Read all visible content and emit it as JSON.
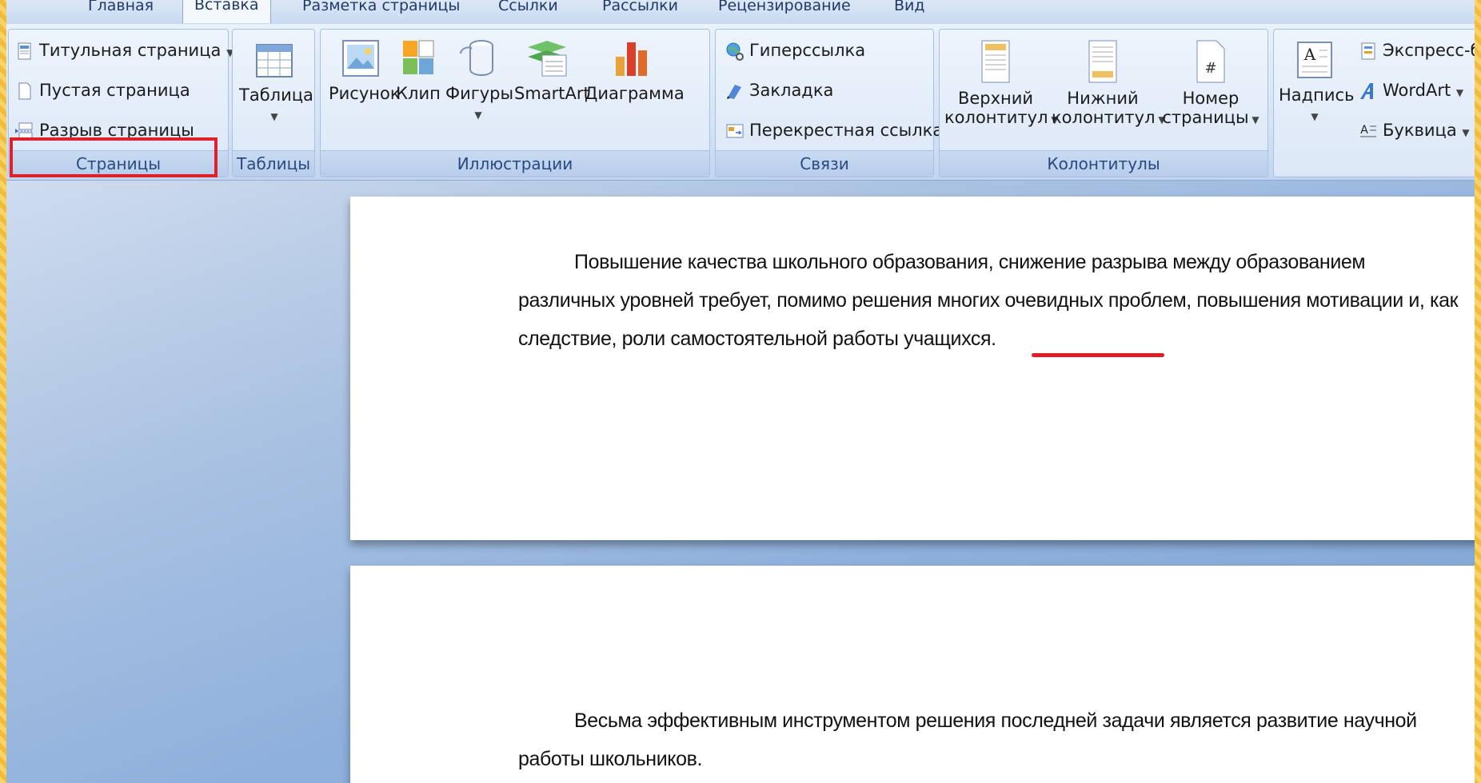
{
  "tabs": [
    "Главная",
    "Вставка",
    "Разметка страницы",
    "Ссылки",
    "Рассылки",
    "Рецензирование",
    "Вид"
  ],
  "groups": {
    "pages": {
      "label": "Страницы",
      "items": [
        "Титульная страница",
        "Пустая страница",
        "Разрыв страницы"
      ]
    },
    "tables": {
      "label": "Таблицы",
      "button": "Таблица"
    },
    "illustrations": {
      "label": "Иллюстрации",
      "buttons": [
        "Рисунок",
        "Клип",
        "Фигуры",
        "SmartArt",
        "Диаграмма"
      ]
    },
    "links": {
      "label": "Связи",
      "items": [
        "Гиперссылка",
        "Закладка",
        "Перекрестная ссылка"
      ]
    },
    "headers": {
      "label": "Колонтитулы",
      "buttons": [
        {
          "line1": "Верхний",
          "line2": "колонтитул"
        },
        {
          "line1": "Нижний",
          "line2": "колонтитул"
        },
        {
          "line1": "Номер",
          "line2": "страницы"
        }
      ]
    },
    "text": {
      "button": "Надпись",
      "items": [
        "Экспресс-бл",
        "WordArt",
        "Буквица"
      ]
    }
  },
  "document": {
    "page1_paragraph": "Повышение качества школьного образования, снижение разрыва между образованием различных уровней требует, помимо решения многих очевидных проблем, повышения мотивации и, как следствие, роли самостоятельной работы учащихся.",
    "page2_paragraph": "Весьма эффективным инструментом решения последней задачи является развитие научной работы школьников."
  },
  "colors": {
    "highlight": "#e0202a",
    "underline": "#e01b24",
    "ribbon_text": "#2a4a7f"
  }
}
